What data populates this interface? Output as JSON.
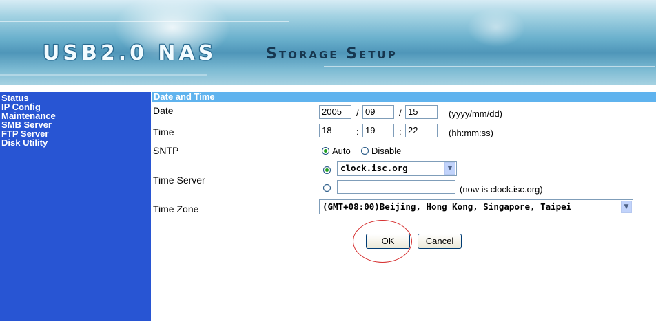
{
  "banner": {
    "title": "USB2.0 NAS",
    "subtitle": "Storage Setup"
  },
  "sidebar": {
    "items": [
      {
        "label": "Status"
      },
      {
        "label": "IP Config"
      },
      {
        "label": "Maintenance"
      },
      {
        "label": "SMB Server"
      },
      {
        "label": "FTP Server"
      },
      {
        "label": "Disk Utility"
      }
    ]
  },
  "section": {
    "title": "Date and Time"
  },
  "form": {
    "date": {
      "label": "Date",
      "year": "2005",
      "month": "09",
      "day": "15",
      "sep": "/",
      "format": "(yyyy/mm/dd)"
    },
    "time": {
      "label": "Time",
      "hour": "18",
      "minute": "19",
      "second": "22",
      "sep": ":",
      "format": "(hh:mm:ss)"
    },
    "sntp": {
      "label": "SNTP",
      "auto_label": "Auto",
      "disable_label": "Disable",
      "selected": "Auto"
    },
    "time_server": {
      "label": "Time Server",
      "selected_option": "clock.isc.org",
      "custom_value": "",
      "current_note": "(now is clock.isc.org)",
      "selected": "list"
    },
    "time_zone": {
      "label": "Time Zone",
      "selected_option": "(GMT+08:00)Beijing, Hong Kong, Singapore, Taipei"
    }
  },
  "buttons": {
    "ok": "OK",
    "cancel": "Cancel"
  },
  "annotation": {
    "color": "#d63030"
  },
  "colors": {
    "sidebar": "#2855d3",
    "section_header": "#5fb3ee",
    "radio_selected": "#21a121"
  },
  "icons": {
    "dropdown": "chevron-down-icon",
    "radio": "radio-icon"
  }
}
